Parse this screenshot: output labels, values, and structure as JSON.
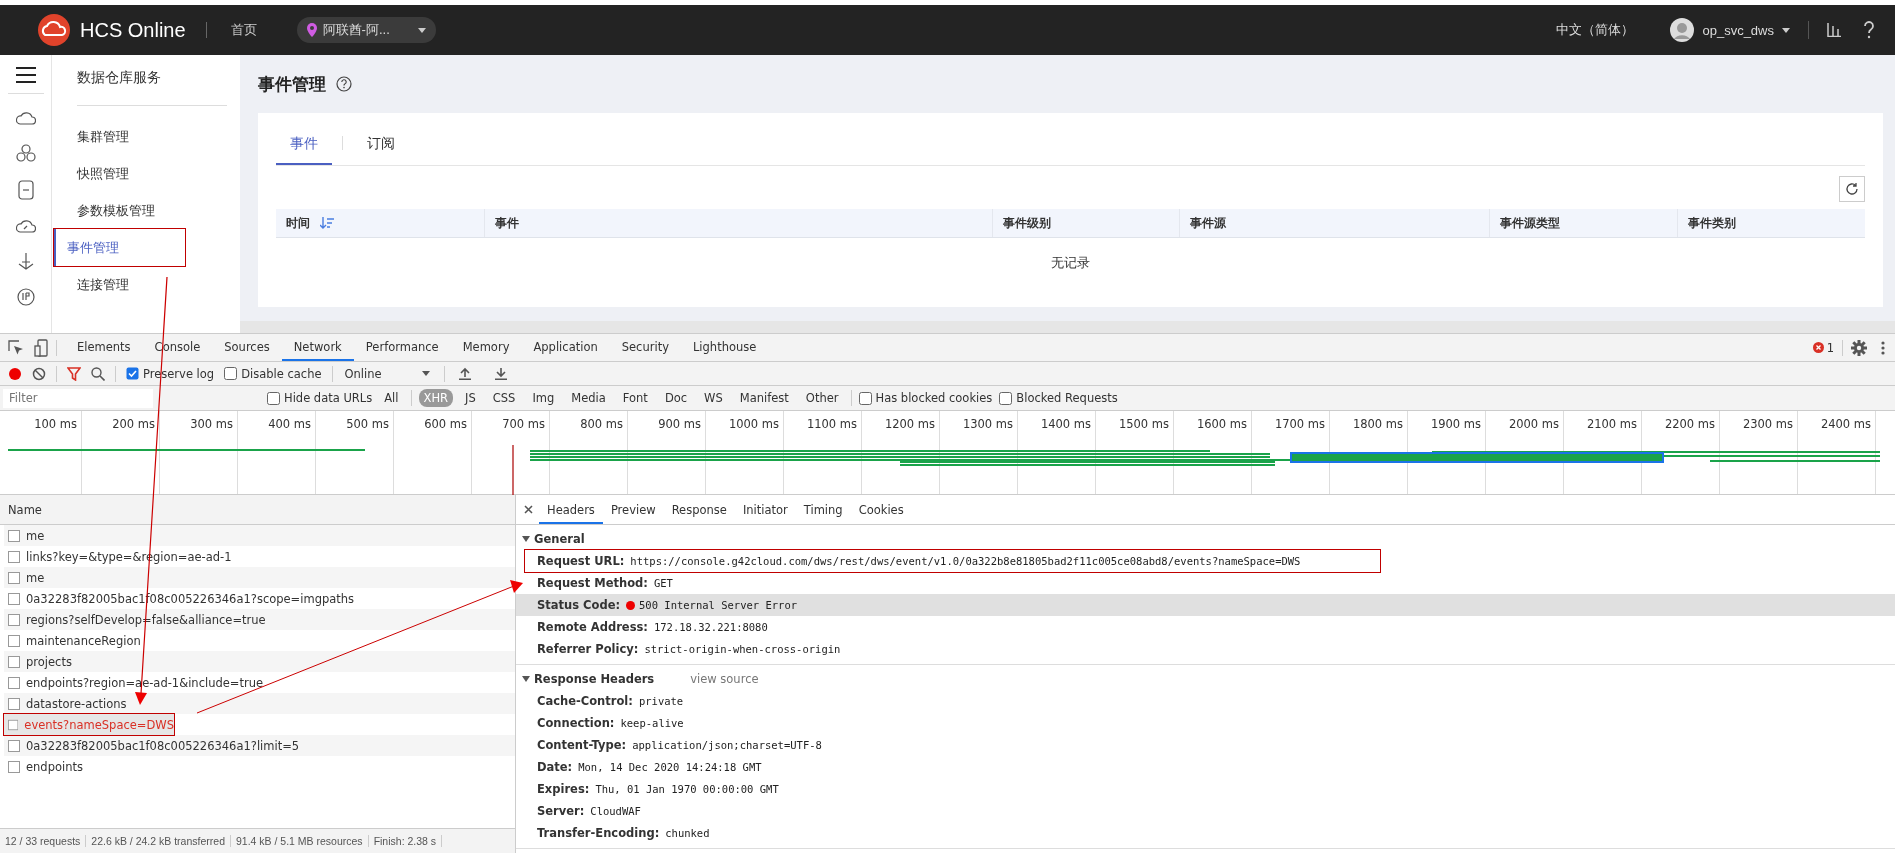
{
  "topbar": {
    "brand": "HCS Online",
    "home": "首页",
    "region": "阿联酋-阿...",
    "language": "中文（简体）",
    "user": "op_svc_dws"
  },
  "sidebar": {
    "title": "数据仓库服务",
    "items": [
      {
        "label": "集群管理",
        "selected": false,
        "annotated": false
      },
      {
        "label": "快照管理",
        "selected": false,
        "annotated": false
      },
      {
        "label": "参数模板管理",
        "selected": false,
        "annotated": false
      },
      {
        "label": "事件管理",
        "selected": true,
        "annotated": true
      },
      {
        "label": "连接管理",
        "selected": false,
        "annotated": false
      }
    ]
  },
  "page": {
    "title": "事件管理",
    "tabs": [
      {
        "label": "事件",
        "selected": true
      },
      {
        "label": "订阅",
        "selected": false
      }
    ],
    "table": {
      "columns": [
        "时间",
        "事件",
        "事件级别",
        "事件源",
        "事件源类型",
        "事件类别"
      ],
      "empty_text": "无记录"
    }
  },
  "devtools": {
    "tabs": [
      {
        "label": "Elements",
        "selected": false
      },
      {
        "label": "Console",
        "selected": false
      },
      {
        "label": "Sources",
        "selected": false
      },
      {
        "label": "Network",
        "selected": true
      },
      {
        "label": "Performance",
        "selected": false
      },
      {
        "label": "Memory",
        "selected": false
      },
      {
        "label": "Application",
        "selected": false
      },
      {
        "label": "Security",
        "selected": false
      },
      {
        "label": "Lighthouse",
        "selected": false
      }
    ],
    "error_count": "1",
    "toolbar": {
      "preserve_log": {
        "label": "Preserve log",
        "checked": true
      },
      "disable_cache": {
        "label": "Disable cache",
        "checked": false
      },
      "throttling": "Online"
    },
    "filter": {
      "placeholder": "Filter",
      "hide_data_urls": {
        "label": "Hide data URLs",
        "checked": false
      },
      "types": [
        {
          "label": "All",
          "selected": false
        },
        {
          "label": "XHR",
          "selected": true
        },
        {
          "label": "JS",
          "selected": false
        },
        {
          "label": "CSS",
          "selected": false
        },
        {
          "label": "Img",
          "selected": false
        },
        {
          "label": "Media",
          "selected": false
        },
        {
          "label": "Font",
          "selected": false
        },
        {
          "label": "Doc",
          "selected": false
        },
        {
          "label": "WS",
          "selected": false
        },
        {
          "label": "Manifest",
          "selected": false
        },
        {
          "label": "Other",
          "selected": false
        }
      ],
      "has_blocked_cookies": {
        "label": "Has blocked cookies",
        "checked": false
      },
      "blocked_requests": {
        "label": "Blocked Requests",
        "checked": false
      }
    },
    "timeline": {
      "ticks": [
        "100 ms",
        "200 ms",
        "300 ms",
        "400 ms",
        "500 ms",
        "600 ms",
        "700 ms",
        "800 ms",
        "900 ms",
        "1000 ms",
        "1100 ms",
        "1200 ms",
        "1300 ms",
        "1400 ms",
        "1500 ms",
        "1600 ms",
        "1700 ms",
        "1800 ms",
        "1900 ms",
        "2000 ms",
        "2100 ms",
        "2200 ms",
        "2300 ms",
        "2400 ms"
      ]
    },
    "requests": {
      "column": "Name",
      "rows": [
        {
          "name": "me",
          "selected": false,
          "error": false,
          "annotated": false
        },
        {
          "name": "links?key=&type=&region=ae-ad-1",
          "selected": false,
          "error": false,
          "annotated": false
        },
        {
          "name": "me",
          "selected": false,
          "error": false,
          "annotated": false
        },
        {
          "name": "0a32283f82005bac1f08c005226346a1?scope=imgpaths",
          "selected": false,
          "error": false,
          "annotated": false
        },
        {
          "name": "regions?selfDevelop=false&alliance=true",
          "selected": false,
          "error": false,
          "annotated": false
        },
        {
          "name": "maintenanceRegion",
          "selected": false,
          "error": false,
          "annotated": false
        },
        {
          "name": "projects",
          "selected": false,
          "error": false,
          "annotated": false
        },
        {
          "name": "endpoints?region=ae-ad-1&include=true",
          "selected": false,
          "error": false,
          "annotated": false
        },
        {
          "name": "datastore-actions",
          "selected": false,
          "error": false,
          "annotated": false
        },
        {
          "name": "events?nameSpace=DWS",
          "selected": true,
          "error": true,
          "annotated": true
        },
        {
          "name": "0a32283f82005bac1f08c005226346a1?limit=5",
          "selected": false,
          "error": false,
          "annotated": false
        },
        {
          "name": "endpoints",
          "selected": false,
          "error": false,
          "annotated": false
        }
      ]
    },
    "status_bar": [
      "12 / 33 requests",
      "22.6 kB / 24.2 kB transferred",
      "91.4 kB / 5.1 MB resources",
      "Finish: 2.38 s"
    ],
    "details": {
      "tabs": [
        {
          "label": "Headers",
          "selected": true
        },
        {
          "label": "Preview",
          "selected": false
        },
        {
          "label": "Response",
          "selected": false
        },
        {
          "label": "Initiator",
          "selected": false
        },
        {
          "label": "Timing",
          "selected": false
        },
        {
          "label": "Cookies",
          "selected": false
        }
      ],
      "sections": [
        {
          "title": "General",
          "expanded": true,
          "rows": [
            {
              "key": "Request URL:",
              "value": "https://console.g42cloud.com/dws/rest/dws/event/v1.0/0a322b8e81805bad2f11c005ce08abd8/events?nameSpace=DWS",
              "kind": "plain",
              "highlighted": false,
              "annotated": true
            },
            {
              "key": "Request Method:",
              "value": "GET",
              "kind": "plain",
              "highlighted": false,
              "annotated": false
            },
            {
              "key": "Status Code:",
              "value": "500 Internal Server Error",
              "kind": "error",
              "highlighted": true,
              "annotated": false
            },
            {
              "key": "Remote Address:",
              "value": "172.18.32.221:8080",
              "kind": "plain",
              "highlighted": false,
              "annotated": false
            },
            {
              "key": "Referrer Policy:",
              "value": "strict-origin-when-cross-origin",
              "kind": "plain",
              "highlighted": false,
              "annotated": false
            }
          ]
        },
        {
          "title": "Response Headers",
          "expanded": true,
          "link": "view source",
          "rows": [
            {
              "key": "Cache-Control:",
              "value": "private",
              "kind": "plain",
              "highlighted": false,
              "annotated": false
            },
            {
              "key": "Connection:",
              "value": "keep-alive",
              "kind": "plain",
              "highlighted": false,
              "annotated": false
            },
            {
              "key": "Content-Type:",
              "value": "application/json;charset=UTF-8",
              "kind": "plain",
              "highlighted": false,
              "annotated": false
            },
            {
              "key": "Date:",
              "value": "Mon, 14 Dec 2020 14:24:18 GMT",
              "kind": "plain",
              "highlighted": false,
              "annotated": false
            },
            {
              "key": "Expires:",
              "value": "Thu, 01 Jan 1970 00:00:00 GMT",
              "kind": "plain",
              "highlighted": false,
              "annotated": false
            },
            {
              "key": "Server:",
              "value": "CloudWAF",
              "kind": "plain",
              "highlighted": false,
              "annotated": false
            },
            {
              "key": "Transfer-Encoding:",
              "value": "chunked",
              "kind": "plain",
              "highlighted": false,
              "annotated": false
            }
          ]
        }
      ]
    }
  }
}
